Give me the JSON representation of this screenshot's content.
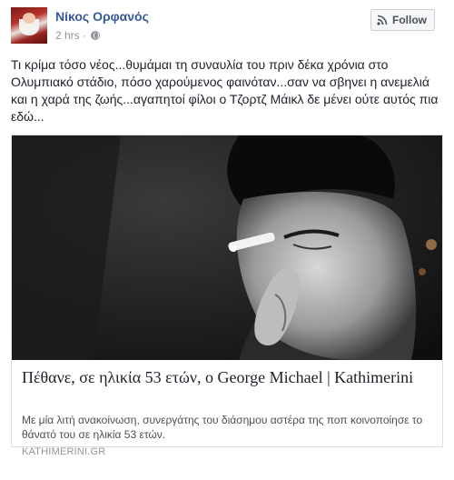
{
  "post": {
    "author": "Νίκος Ορφανός",
    "time": "2 hrs",
    "separator": "·",
    "audience_icon": "globe-icon",
    "follow_label": "Follow",
    "follow_icon": "rss-icon",
    "text": "Τι κρίμα τόσο νέος...θυμάμαι τη συναυλία του πριν δέκα χρόνια στο Ολυμπιακό στάδιο, πόσο χαρούμενος φαινόταν...σαν να σβηνει η ανεμελιά και η χαρά της ζωής...αγαπητοί φίλοι ο Τζορτζ Μάικλ δε μένει ούτε αυτός πια εδώ..."
  },
  "link_card": {
    "title": "Πέθανε, σε ηλικία 53 ετών, ο George Michael | Kathimerini",
    "description": "Με μία λιτή ανακοίνωση, συνεργάτης του διάσημου αστέρα της ποπ κοινοποίησε το θάνατό του σε ηλικία 53 ετών.",
    "domain": "KATHIMERINI.GR"
  },
  "colors": {
    "author_link": "#365899",
    "meta_gray": "#90949c",
    "text": "#1d2129",
    "border": "#dddfe2"
  }
}
